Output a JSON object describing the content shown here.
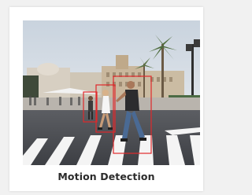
{
  "card": {
    "caption": "Motion Detection",
    "image_description_icon": "photo-street-crosswalk",
    "detection_box_color": "#e0282b"
  }
}
